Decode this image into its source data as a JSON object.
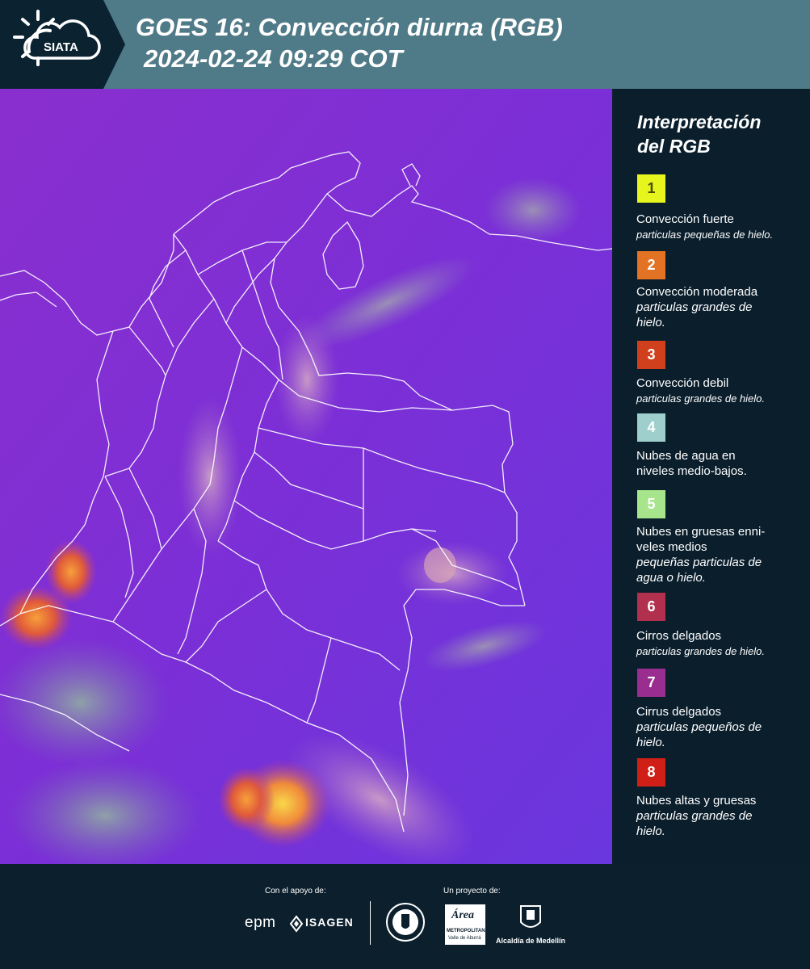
{
  "header": {
    "logo_text": "SIATA",
    "title_line1": "GOES 16: Convección diurna (RGB)",
    "title_line2": "2024-02-24 09:29 COT",
    "background": "#4f7a87"
  },
  "legend": {
    "title_line1": "Interpretación",
    "title_line2": "del RGB",
    "items": [
      {
        "number": "1",
        "color": "#e6f51e",
        "text_color": "#4a4a00",
        "name": "Convección fuerte",
        "desc": "particulas pequeñas de hielo."
      },
      {
        "number": "2",
        "color": "#e27224",
        "text_color": "#ffffff",
        "name": "Convección moderada",
        "desc": "particulas grandes de hielo."
      },
      {
        "number": "3",
        "color": "#d1401d",
        "text_color": "#ffffff",
        "name": "Convección debil",
        "desc": "particulas grandes de hielo."
      },
      {
        "number": "4",
        "color": "#9fcfcc",
        "text_color": "#ffffff",
        "name": "Nubes de agua en niveles medio-bajos.",
        "desc": ""
      },
      {
        "number": "5",
        "color": "#a6e58b",
        "text_color": "#ffffff",
        "name": "Nubes en gruesas enni-veles medios",
        "desc": "pequeñas particulas de agua o hielo."
      },
      {
        "number": "6",
        "color": "#b0304d",
        "text_color": "#ffffff",
        "name": "Cirros delgados",
        "desc": "particulas grandes de hielo."
      },
      {
        "number": "7",
        "color": "#9a2d90",
        "text_color": "#ffffff",
        "name": "Cirrus delgados",
        "desc": "particulas pequeños de hielo."
      },
      {
        "number": "8",
        "color": "#cf1f16",
        "text_color": "#ffffff",
        "name": "Nubes altas y gruesas",
        "desc": "particulas grandes de hielo."
      }
    ]
  },
  "footer": {
    "support_label": "Con el apoyo de:",
    "project_label": "Un proyecto de:",
    "sponsor1": "epm",
    "sponsor2": "ISAGEN",
    "partner_area_line1": "Área",
    "partner_area_line2": "METROPOLITANA",
    "partner_area_line3": "Valle de Aburrá",
    "partner_alcaldia": "Alcaldía de Medellín"
  },
  "map": {
    "background": "#7a2fd8",
    "border_color": "#ffffff"
  }
}
